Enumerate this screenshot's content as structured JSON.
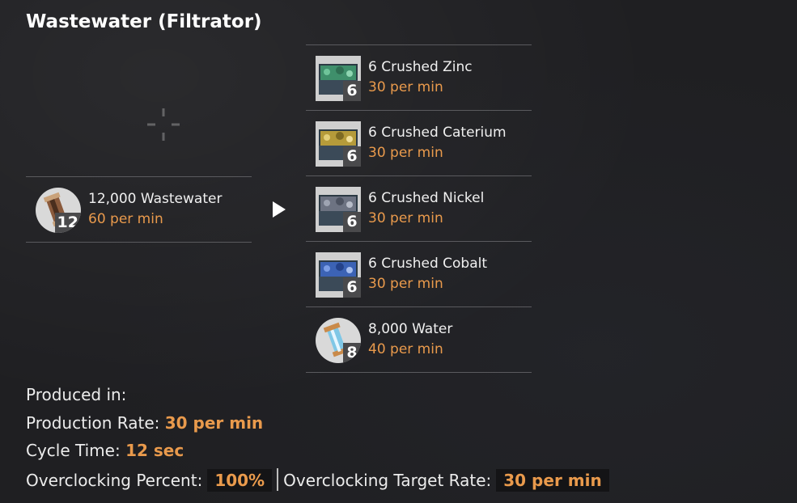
{
  "recipe": {
    "title": "Wastewater (Filtrator)"
  },
  "input": {
    "name": "12,000 Wastewater",
    "rate": "60 per min",
    "badge": "12",
    "icon": "wastewater-canister-icon"
  },
  "outputs": [
    {
      "name": "6 Crushed Zinc",
      "rate": "30 per min",
      "badge": "6",
      "icon": "crushed-zinc-icon",
      "color": "#3f8f6b"
    },
    {
      "name": "6 Crushed Caterium",
      "rate": "30 per min",
      "badge": "6",
      "icon": "crushed-caterium-icon",
      "color": "#b59b3a"
    },
    {
      "name": "6 Crushed Nickel",
      "rate": "30 per min",
      "badge": "6",
      "icon": "crushed-nickel-icon",
      "color": "#6d7382"
    },
    {
      "name": "6 Crushed Cobalt",
      "rate": "30 per min",
      "badge": "6",
      "icon": "crushed-cobalt-icon",
      "color": "#3c63b5"
    },
    {
      "name": "8,000 Water",
      "rate": "40 per min",
      "badge": "8",
      "icon": "water-canister-icon",
      "color": "#7fc7e6"
    }
  ],
  "stats": {
    "produced_in_label": "Produced in:",
    "production_rate_label": "Production Rate:",
    "production_rate_value": "30 per min",
    "cycle_time_label": "Cycle Time:",
    "cycle_time_value": "12 sec",
    "overclock_percent_label": "Overclocking Percent:",
    "overclock_percent_value": "100%",
    "overclock_target_label": "Overclocking Target Rate:",
    "overclock_target_value": "30 per min"
  },
  "colors": {
    "accent": "#e99a4c",
    "background": "#1f1f22",
    "divider": "#5a5a5e"
  }
}
